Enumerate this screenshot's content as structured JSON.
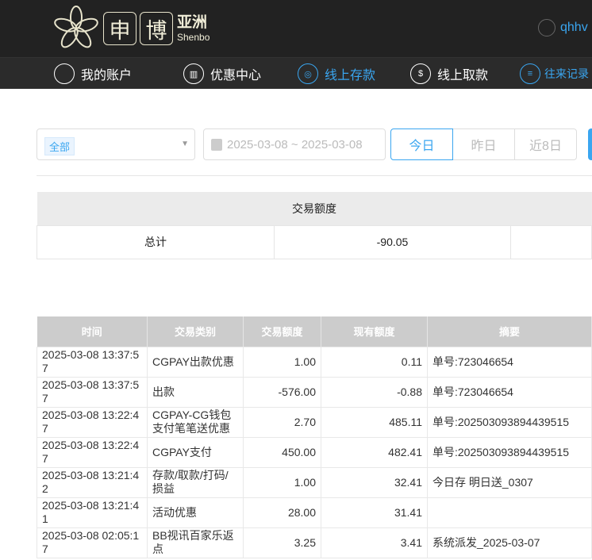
{
  "header": {
    "logo_box1": "申",
    "logo_box2": "博",
    "logo_cn": "亚洲",
    "logo_en": "Shenbo",
    "username": "qhhv"
  },
  "nav": [
    {
      "label": "我的账户",
      "icon": "user-icon"
    },
    {
      "label": "优惠中心",
      "icon": "gift-icon"
    },
    {
      "label": "线上存款",
      "icon": "deposit-icon"
    },
    {
      "label": "线上取款",
      "icon": "withdraw-icon"
    },
    {
      "label": "往来记录",
      "icon": "record-icon"
    }
  ],
  "colors": {
    "accent": "#3aa6f0",
    "header_bg": "#222222"
  },
  "filter": {
    "type_tag": "全部",
    "date_range": "2025-03-08 ~ 2025-03-08",
    "quick": [
      "今日",
      "昨日",
      "近8日"
    ],
    "active": "今日"
  },
  "summary": {
    "header": "交易额度",
    "label": "总计",
    "value": "-90.05"
  },
  "table": {
    "columns": [
      "时间",
      "交易类别",
      "交易额度",
      "现有额度",
      "摘要"
    ],
    "rows": [
      [
        "2025-03-08 13:37:57",
        "CGPAY出款优惠",
        "1.00",
        "0.11",
        "单号:723046654"
      ],
      [
        "2025-03-08 13:37:57",
        "出款",
        "-576.00",
        "-0.88",
        "单号:723046654"
      ],
      [
        "2025-03-08 13:22:47",
        "CGPAY-CG钱包支付笔笔送优惠",
        "2.70",
        "485.11",
        "单号:202503093894439515"
      ],
      [
        "2025-03-08 13:22:47",
        "CGPAY支付",
        "450.00",
        "482.41",
        "单号:202503093894439515"
      ],
      [
        "2025-03-08 13:21:42",
        "存款/取款/打码/损益",
        "1.00",
        "32.41",
        "今日存 明日送_0307"
      ],
      [
        "2025-03-08 13:21:41",
        "活动优惠",
        "28.00",
        "31.41",
        ""
      ],
      [
        "2025-03-08 02:05:17",
        "BB视讯百家乐返点",
        "3.25",
        "3.41",
        "系统派发_2025-03-07"
      ]
    ]
  }
}
